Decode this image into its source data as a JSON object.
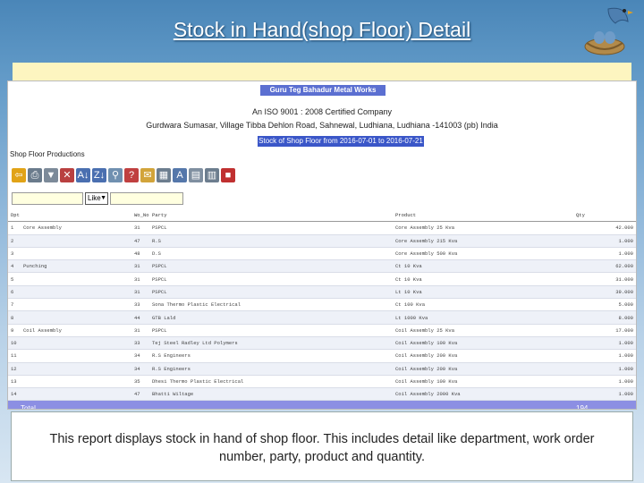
{
  "slide": {
    "title": "Stock in Hand(shop Floor) Detail",
    "caption": "This report displays stock in hand of shop floor. This includes detail like department, work order number, party, product and quantity."
  },
  "report": {
    "company": "Guru Teg Bahadur Metal Works",
    "iso": "An ISO 9001 : 2008 Certified Company",
    "address": "Gurdwara Sumasar, Village Tibba Dehlon Road, Sahnewal, Ludhiana, Ludhiana -141003 (pb) India",
    "date_range": "Stock of Shop Floor from 2016-07-01 to 2016-07-21",
    "module": "Shop Floor Productions"
  },
  "filter": {
    "operator": "Like"
  },
  "toolbar": [
    {
      "icon": "back-arrow-icon",
      "glyph": "⇦",
      "color": "#e1a317"
    },
    {
      "icon": "print-icon",
      "glyph": "⎙",
      "color": "#6a7b8c"
    },
    {
      "icon": "filter-icon",
      "glyph": "▼",
      "color": "#7c8a99"
    },
    {
      "icon": "clear-filter-icon",
      "glyph": "✕",
      "color": "#b94040"
    },
    {
      "icon": "sort-ascending-icon",
      "glyph": "A↓",
      "color": "#4a6fb0"
    },
    {
      "icon": "sort-descending-icon",
      "glyph": "Z↓",
      "color": "#4a6fb0"
    },
    {
      "icon": "search-icon",
      "glyph": "⚲",
      "color": "#7090b0"
    },
    {
      "icon": "help-icon",
      "glyph": "?",
      "color": "#c04040"
    },
    {
      "icon": "email-icon",
      "glyph": "✉",
      "color": "#d2a43a"
    },
    {
      "icon": "grid-icon",
      "glyph": "▦",
      "color": "#6c7d8e"
    },
    {
      "icon": "font-icon",
      "glyph": "A",
      "color": "#5577aa"
    },
    {
      "icon": "document-icon",
      "glyph": "▤",
      "color": "#7f8fa0"
    },
    {
      "icon": "table-icon",
      "glyph": "▥",
      "color": "#6c7d8e"
    },
    {
      "icon": "save-icon",
      "glyph": "■",
      "color": "#c03030"
    }
  ],
  "table": {
    "headers": [
      "Dpt Dep",
      "",
      "Wo_No",
      "Party",
      "Product",
      "Qty"
    ],
    "rows": [
      [
        "1",
        "Core Assembly",
        "31",
        "PSPCL",
        "Core Assembly 25 Kva",
        "42.000"
      ],
      [
        "2",
        "",
        "47",
        "R.S",
        "Core Assembly 215 Kva",
        "1.000"
      ],
      [
        "3",
        "",
        "48",
        "D.S",
        "Core Assembly 500 Kva",
        "1.000"
      ],
      [
        "4",
        "Punching",
        "31",
        "PSPCL",
        "Ct 10 Kva",
        "62.000"
      ],
      [
        "5",
        "",
        "31",
        "PSPCL",
        "Ct 10 Kva",
        "31.000"
      ],
      [
        "6",
        "",
        "31",
        "PSPCL",
        "Lt 10 Kva",
        "39.000"
      ],
      [
        "7",
        "",
        "33",
        "Sona Thermo Plastic Electrical",
        "Ct 100 Kva",
        "5.000"
      ],
      [
        "8",
        "",
        "44",
        "GTB Lald",
        "Lt 1000 Kva",
        "8.000"
      ],
      [
        "9",
        "Coil Assembly",
        "31",
        "PSPCL",
        "Coil Assembly 25 Kva",
        "17.000"
      ],
      [
        "10",
        "",
        "33",
        "Tej Steel Radley Ltd Polymers",
        "Coil Assembly 100 Kva",
        "1.000"
      ],
      [
        "11",
        "",
        "34",
        "R.S Engineers",
        "Coil Assembly 200 Kva",
        "1.000"
      ],
      [
        "12",
        "",
        "34",
        "R.S Engineers",
        "Coil Assembly 200 Kva",
        "1.000"
      ],
      [
        "13",
        "",
        "35",
        "Dhesi Thermo Plastic Electrical",
        "Coil Assembly 100 Kva",
        "1.000"
      ],
      [
        "14",
        "",
        "47",
        "Bhatti Wiltage",
        "Coil Assembly 2000 Kva",
        "1.000"
      ]
    ],
    "total_label": "Total",
    "total_qty": "194"
  }
}
